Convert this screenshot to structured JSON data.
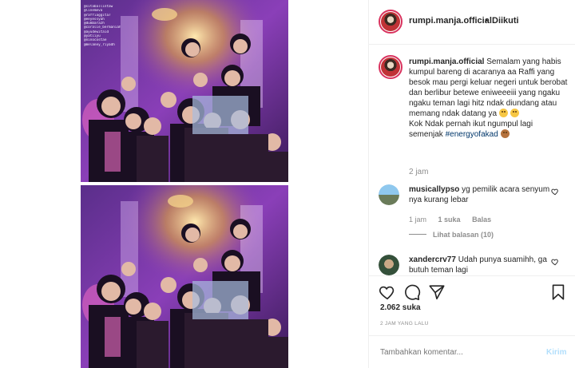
{
  "post": {
    "username": "rumpi.manja.official",
    "follow_separator": "•",
    "follow_status": "Diikuti",
    "story_lines": [
      "@sitaballintaw",
      "@linemeva",
      "@raffiaggita7",
      "@eeyessyah",
      "@dumbarazh",
      "@coralie_bermaniah",
      "@ayudewitaid",
      "@yatiiyu",
      "@ninocostae",
      "@melaney_riyadh"
    ]
  },
  "caption": {
    "username": "rumpi.manja.official",
    "text": "Semalam yang habis kumpul bareng di acaranya aa Raffi yang besok mau pergi keluar negeri untuk berobat dan berlibur betewe eniweeeiii yang ngaku ngaku teman lagi hitz ndak diundang atau memang ndak datang ya",
    "text2": "Kok Ndak pernah ikut ngumpul lagi semenjak",
    "hashtag": "#energyofakad",
    "time": "2 jam"
  },
  "comments": [
    {
      "username": "musicallypso",
      "text": "yg pemilik acara senyum nya kurang lebar",
      "time": "1 jam",
      "likes": "1 suka",
      "reply": "Balas",
      "view_replies": "Lihat balasan (10)"
    },
    {
      "username": "xandercrv77",
      "text": "Udah punya suamihh, ga butuh teman lagi"
    }
  ],
  "stats": {
    "likes": "2.062 suka",
    "time": "2 JAM YANG LALU"
  },
  "add_comment": {
    "placeholder": "Tambahkan komentar...",
    "send_label": "Kirim"
  },
  "colors": {
    "accent": "#0095f6",
    "send_disabled": "#b2dffc",
    "avatar_ring": "#d9325e"
  }
}
